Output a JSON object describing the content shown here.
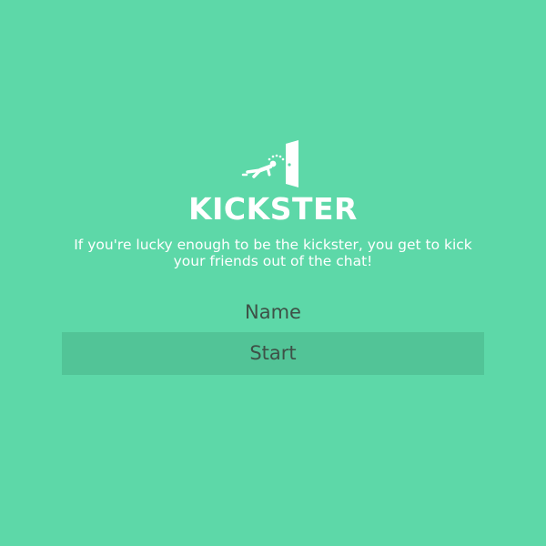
{
  "app": {
    "title": "KICKSTER",
    "tagline": "If you're lucky enough to be the kickster, you get to kick your friends out of the chat!",
    "logo_icon": "kick-out-door-icon"
  },
  "form": {
    "name_placeholder": "Name",
    "name_value": "",
    "start_label": "Start"
  },
  "colors": {
    "background": "#5dd8a8",
    "button_background": "#52c497",
    "text_light": "#ffffff",
    "text_dark": "#3e5147"
  }
}
